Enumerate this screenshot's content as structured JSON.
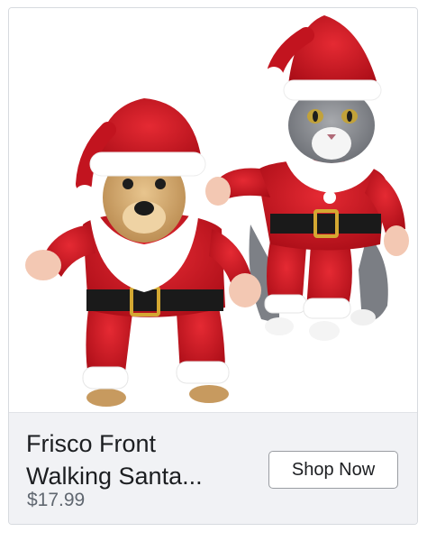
{
  "ad": {
    "image_name": "santa-pet-costumes-photo",
    "title": "Frisco Front Walking Santa...",
    "price": "$17.99",
    "cta_label": "Shop Now"
  },
  "colors": {
    "costume_red": "#d0121f",
    "fur_white": "#ffffff",
    "footer_bg": "#f1f2f5",
    "title_text": "#1c1e21",
    "price_text": "#606770"
  }
}
